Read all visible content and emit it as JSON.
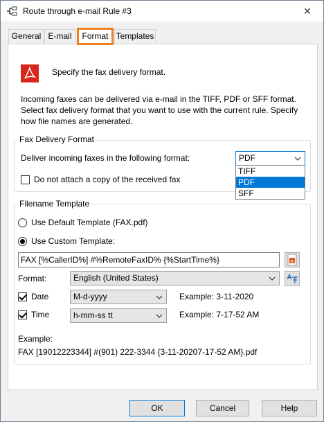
{
  "window": {
    "title": "Route through e-mail Rule #3",
    "close_label": "✕"
  },
  "tabs": [
    {
      "label": "General",
      "active": false
    },
    {
      "label": "E-mail",
      "active": false
    },
    {
      "label": "Format",
      "active": true
    },
    {
      "label": "Templates",
      "active": false
    }
  ],
  "header": {
    "text": "Specify the fax delivery format."
  },
  "description": {
    "line1": "Incoming faxes can be delivered via e-mail in the TIFF, PDF or SFF format.",
    "line2": "Select fax delivery format that you want to use with the current rule. Specify",
    "line3": "how file names are generated."
  },
  "fax_delivery": {
    "group_title": "Fax Delivery Format",
    "deliver_label": "Deliver incoming faxes in the following format:",
    "selected_format": "PDF",
    "options": [
      "TIFF",
      "PDF",
      "SFF"
    ],
    "no_attach_label": "Do not attach a copy of the received fax",
    "no_attach_checked": false
  },
  "filename_template": {
    "group_title": "Filename Template",
    "default_radio_label": "Use Default Template (FAX.pdf)",
    "custom_radio_label": "Use Custom Template:",
    "custom_selected": true,
    "template_value": "FAX [%CallerID%] #%RemoteFaxID% {%StartTime%}",
    "format_label": "Format:",
    "format_value": "English (United States)",
    "date_label": "Date",
    "date_checked": true,
    "date_format": "M-d-yyyy",
    "date_example": "Example: 3-11-2020",
    "time_label": "Time",
    "time_checked": true,
    "time_format": "h-mm-ss tt",
    "time_example": "Example: 7-17-52 AM",
    "example_label": "Example:",
    "example_value": "FAX [19012223344] #(901) 222-3344 {3-11-20207-17-52 AM}.pdf"
  },
  "buttons": {
    "ok": "OK",
    "cancel": "Cancel",
    "help": "Help"
  },
  "colors": {
    "accent": "#0078d7",
    "tab_highlight": "#f0801f",
    "pdf_red": "#d9261c"
  }
}
